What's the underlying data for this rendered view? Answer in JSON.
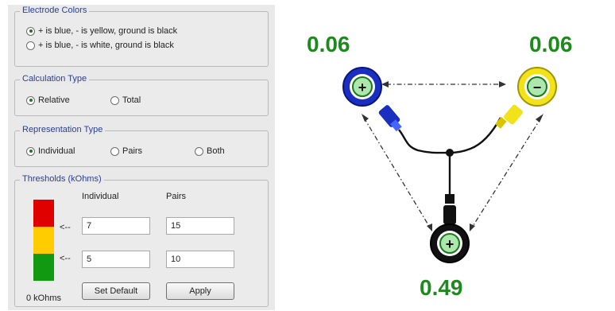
{
  "electrode_colors": {
    "title": "Electrode Colors",
    "options": [
      {
        "label": "+ is blue, - is yellow, ground is black",
        "selected": true
      },
      {
        "label": "+ is blue, - is white, ground is black",
        "selected": false
      }
    ]
  },
  "calculation_type": {
    "title": "Calculation Type",
    "options": [
      {
        "label": "Relative",
        "selected": true
      },
      {
        "label": "Total",
        "selected": false
      }
    ]
  },
  "representation_type": {
    "title": "Representation Type",
    "options": [
      {
        "label": "Individual",
        "selected": true
      },
      {
        "label": "Pairs",
        "selected": false
      },
      {
        "label": "Both",
        "selected": false
      }
    ]
  },
  "thresholds": {
    "title": "Thresholds (kOhms)",
    "col_individual": "Individual",
    "col_pairs": "Pairs",
    "arrow": "<--",
    "upper": {
      "individual": "7",
      "pairs": "15"
    },
    "lower": {
      "individual": "5",
      "pairs": "10"
    },
    "scale_label": "0 kOhms",
    "colors": {
      "high": "#e00000",
      "mid": "#ffcc00",
      "low": "#119911"
    },
    "set_default_label": "Set Default",
    "apply_label": "Apply"
  },
  "diagram": {
    "positive": {
      "value": "0.06",
      "symbol": "+",
      "color": "#1a2fc0"
    },
    "negative": {
      "value": "0.06",
      "symbol": "−",
      "color": "#f2e21a"
    },
    "ground": {
      "value": "0.49",
      "symbol": "+",
      "color": "#111111"
    },
    "value_color": "#1e8a1e"
  }
}
